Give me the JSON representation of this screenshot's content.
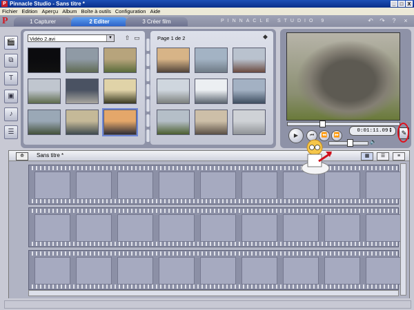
{
  "window": {
    "title": "Pinnacle Studio - Sans titre *",
    "app_icon": "P",
    "buttons": [
      "_",
      "□",
      "X"
    ]
  },
  "menu": [
    "Fichier",
    "Edition",
    "Aperçu",
    "Album",
    "Boîte à outils",
    "Configuration",
    "Aide"
  ],
  "tabs": [
    {
      "label": "1 Capturer",
      "active": false
    },
    {
      "label": "2 Editer",
      "active": true
    },
    {
      "label": "3 Créer film",
      "active": false
    }
  ],
  "brand": "PINNACLE STUDIO 9",
  "top_icons": [
    "undo-icon",
    "redo-icon",
    "help-icon",
    "close-icon"
  ],
  "album": {
    "source_file": "Vidéo 2.avi",
    "page_label": "Page 1 de 2",
    "left_thumbs": [
      {
        "colors": [
          "#0b0b0e",
          "#111"
        ]
      },
      {
        "colors": [
          "#8f9aa5",
          "#5f6a52"
        ]
      },
      {
        "colors": [
          "#b7a47c",
          "#596a3a"
        ]
      },
      {
        "colors": [
          "#c0c6cf",
          "#5e6b4b"
        ]
      },
      {
        "colors": [
          "#4a5262",
          "#a9a7a0"
        ]
      },
      {
        "colors": [
          "#e0d3a8",
          "#3a3a22"
        ]
      },
      {
        "colors": [
          "#9aa8b6",
          "#44513a"
        ]
      },
      {
        "colors": [
          "#c5b998",
          "#3f4a4e"
        ]
      },
      {
        "colors": [
          "#e4a76a",
          "#2f2d35"
        ],
        "selected": true
      }
    ],
    "right_thumbs": [
      {
        "colors": [
          "#d7b487",
          "#51443a"
        ]
      },
      {
        "colors": [
          "#a3b3c4",
          "#6e7a85"
        ]
      },
      {
        "colors": [
          "#b9c2ce",
          "#6b4a3f"
        ]
      },
      {
        "colors": [
          "#cfd6de",
          "#7b7f7c"
        ]
      },
      {
        "colors": [
          "#eceff2",
          "#5a646f"
        ]
      },
      {
        "colors": [
          "#a3b1c3",
          "#3e4d60"
        ]
      },
      {
        "colors": [
          "#b5bfc8",
          "#4c5e2f"
        ]
      },
      {
        "colors": [
          "#cdbfa8",
          "#5b5046"
        ]
      },
      {
        "colors": [
          "#cfd2d6",
          "#8f9296"
        ]
      }
    ]
  },
  "player": {
    "timecode": "0:01:11.09",
    "progress": 0.3,
    "volume": 0.55
  },
  "timeline": {
    "title": "Sans titre *",
    "rows": 3,
    "cells_per_row": 9,
    "view_modes": [
      "storyboard",
      "timeline",
      "list"
    ]
  }
}
